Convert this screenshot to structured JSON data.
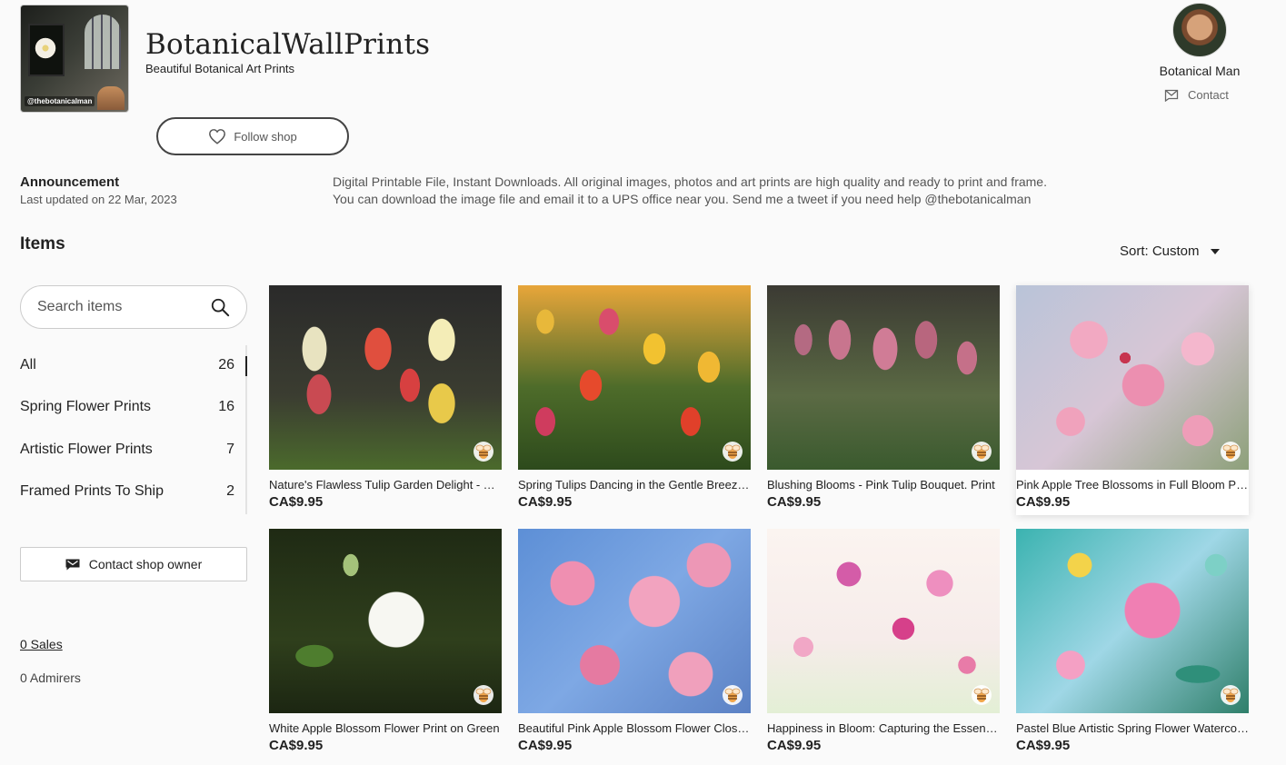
{
  "header": {
    "shop_name": "BotanicalWallPrints",
    "tagline": "Beautiful Botanical Art Prints",
    "logo_handle": "@thebotanicalman",
    "follow_label": "Follow shop"
  },
  "owner": {
    "name": "Botanical Man",
    "contact_label": "Contact"
  },
  "announcement": {
    "title": "Announcement",
    "updated": "Last updated on 22 Mar, 2023",
    "line1": "Digital Printable File, Instant Downloads. All original images, photos and art prints are high quality and ready to print and frame.",
    "line2": "You can download the image file and email it to a UPS office near you. Send me a tweet if you need help @thebotanicalman"
  },
  "items": {
    "title": "Items",
    "sort_label": "Sort: Custom",
    "search_placeholder": "Search items"
  },
  "sections": [
    {
      "label": "All",
      "count": "26"
    },
    {
      "label": "Spring Flower Prints",
      "count": "16"
    },
    {
      "label": "Artistic Flower Prints",
      "count": "7"
    },
    {
      "label": "Framed Prints To Ship",
      "count": "2"
    }
  ],
  "sidebar": {
    "contact_owner_label": "Contact shop owner",
    "sales_label": "0 Sales",
    "admirers_label": "0 Admirers"
  },
  "listings": [
    {
      "title": "Nature's Flawless Tulip Garden Delight - Tulip Flower Print",
      "price": "CA$9.95"
    },
    {
      "title": "Spring Tulips Dancing in the Gentle Breeze Print",
      "price": "CA$9.95"
    },
    {
      "title": "Blushing Blooms - Pink Tulip Bouquet. Print",
      "price": "CA$9.95"
    },
    {
      "title": "Pink Apple Tree Blossoms in Full Bloom Print",
      "price": "CA$9.95"
    },
    {
      "title": "White Apple Blossom Flower Print on Green",
      "price": "CA$9.95"
    },
    {
      "title": "Beautiful Pink Apple Blossom Flower Close-up",
      "price": "CA$9.95"
    },
    {
      "title": "Happiness in Bloom: Capturing the Essence of Spring",
      "price": "CA$9.95"
    },
    {
      "title": "Pastel Blue Artistic Spring Flower Watercolor",
      "price": "CA$9.95"
    }
  ],
  "colors": {
    "text": "#222222",
    "muted": "#555555",
    "border": "#cccccc",
    "background": "#fafafa"
  }
}
